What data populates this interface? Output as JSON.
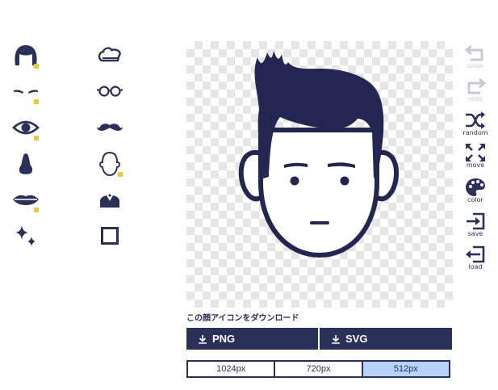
{
  "parts_palette": [
    {
      "name": "hair-part-icon",
      "badge": true
    },
    {
      "name": "hat-part-icon",
      "badge": false
    },
    {
      "name": "eyebrows-part-icon",
      "badge": true
    },
    {
      "name": "glasses-part-icon",
      "badge": false
    },
    {
      "name": "eye-part-icon",
      "badge": true
    },
    {
      "name": "mustache-part-icon",
      "badge": false
    },
    {
      "name": "nose-part-icon",
      "badge": false
    },
    {
      "name": "face-outline-part-icon",
      "badge": true
    },
    {
      "name": "mouth-part-icon",
      "badge": true
    },
    {
      "name": "clothes-part-icon",
      "badge": false
    },
    {
      "name": "sparkle-part-icon",
      "badge": false
    },
    {
      "name": "background-frame-part-icon",
      "badge": false
    }
  ],
  "toolbar": {
    "undo": "undo",
    "redo": "redo",
    "random": "random",
    "move": "move",
    "color": "color",
    "save": "save",
    "load": "load"
  },
  "download": {
    "heading": "この顔アイコンをダウンロード",
    "png_label": "PNG",
    "svg_label": "SVG",
    "sizes": [
      "1024px",
      "720px",
      "512px"
    ],
    "selected_size": "512px"
  },
  "colors": {
    "navy": "#2b3059",
    "accent_yellow": "#e9c83c",
    "selected_blue": "#b8d3f7"
  }
}
